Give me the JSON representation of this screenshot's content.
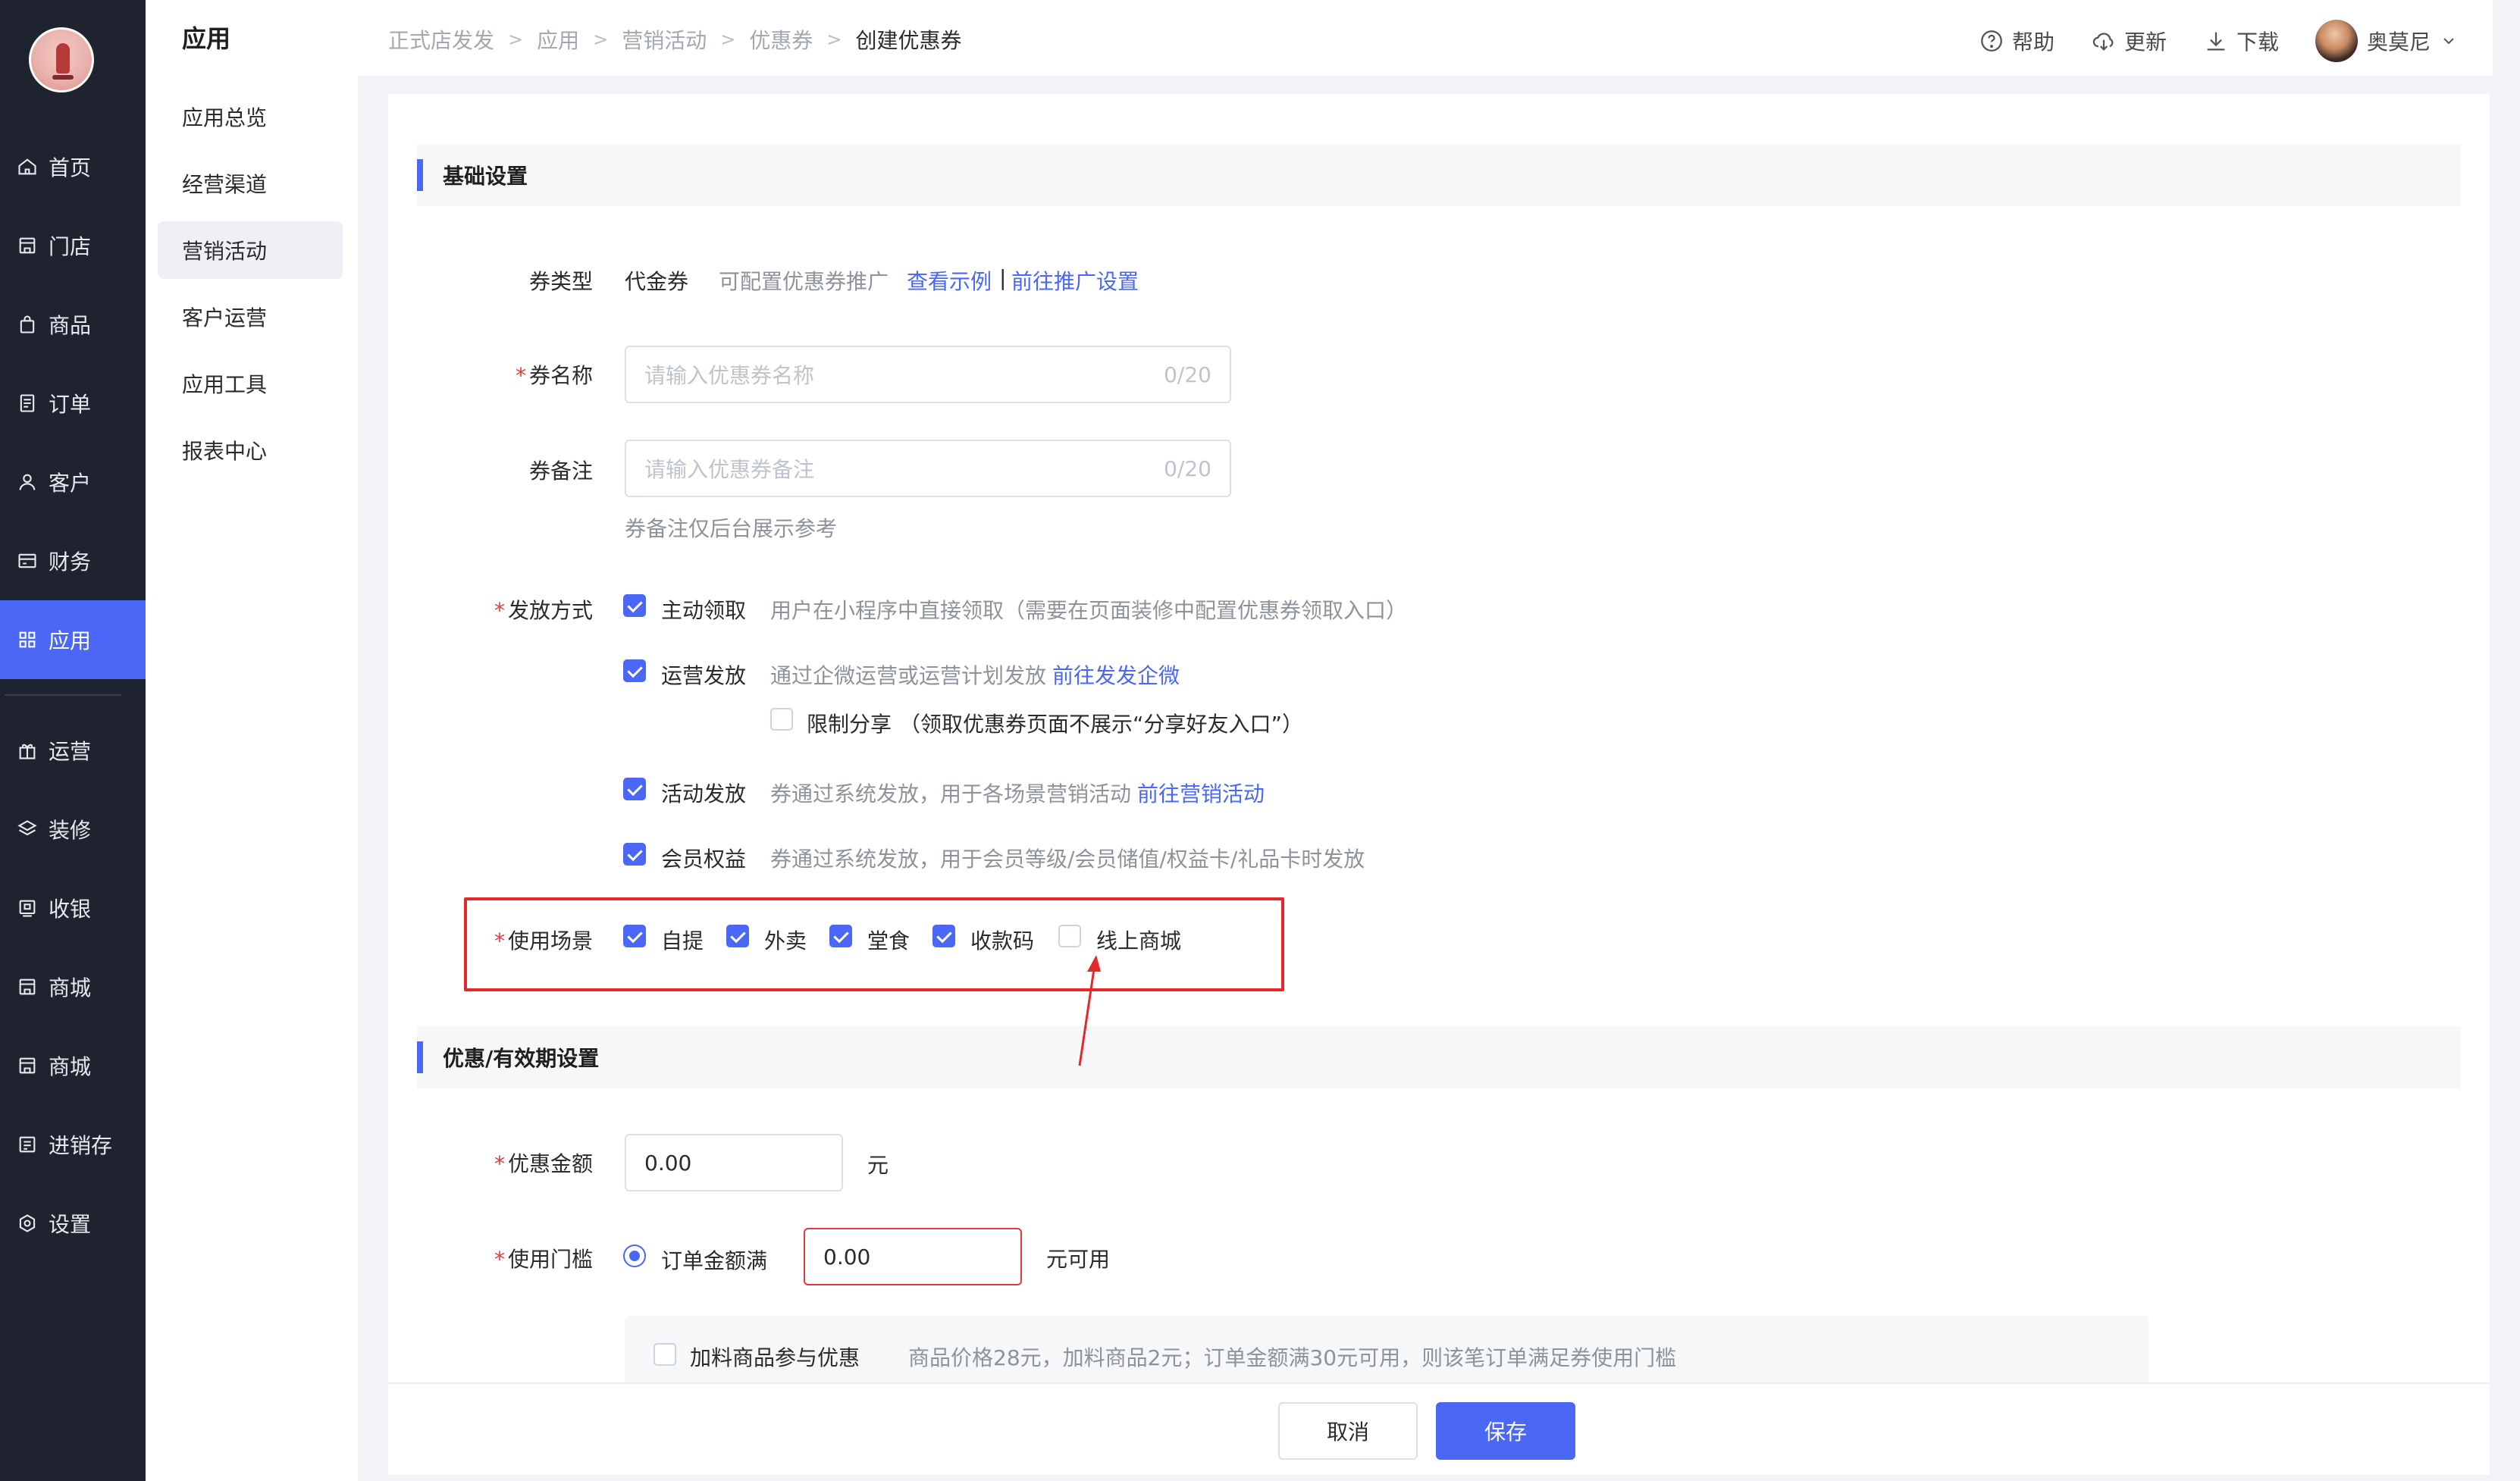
{
  "nav": {
    "items": [
      {
        "label": "首页",
        "icon": "home-icon"
      },
      {
        "label": "门店",
        "icon": "store-icon"
      },
      {
        "label": "商品",
        "icon": "bag-icon"
      },
      {
        "label": "订单",
        "icon": "order-icon"
      },
      {
        "label": "客户",
        "icon": "user-icon"
      },
      {
        "label": "财务",
        "icon": "wallet-icon"
      },
      {
        "label": "应用",
        "icon": "grid-icon",
        "active": true
      },
      {
        "label": "运营",
        "icon": "gift-icon"
      },
      {
        "label": "装修",
        "icon": "layers-icon"
      },
      {
        "label": "收银",
        "icon": "cashier-icon"
      },
      {
        "label": "商城",
        "icon": "store-icon"
      },
      {
        "label": "商城",
        "icon": "store-icon"
      },
      {
        "label": "进销存",
        "icon": "inventory-icon"
      },
      {
        "label": "设置",
        "icon": "settings-icon"
      }
    ]
  },
  "submenu": {
    "title": "应用",
    "items": [
      {
        "label": "应用总览"
      },
      {
        "label": "经营渠道"
      },
      {
        "label": "营销活动",
        "active": true
      },
      {
        "label": "客户运营"
      },
      {
        "label": "应用工具"
      },
      {
        "label": "报表中心"
      }
    ]
  },
  "breadcrumb": [
    "正式店发发",
    "应用",
    "营销活动",
    "优惠券",
    "创建优惠券"
  ],
  "header": {
    "help": "帮助",
    "update": "更新",
    "download": "下载",
    "username": "奥莫尼"
  },
  "basic": {
    "section_title": "基础设置",
    "type_label": "券类型",
    "type_value": "代金券",
    "type_hint": "可配置优惠券推广",
    "type_link1": "查看示例",
    "type_sep": "|",
    "type_link2": "前往推广设置",
    "name_label": "券名称",
    "name_placeholder": "请输入优惠券名称",
    "name_count": "0/20",
    "remark_label": "券备注",
    "remark_placeholder": "请输入优惠券备注",
    "remark_count": "0/20",
    "remark_hint": "券备注仅后台展示参考",
    "method_label": "发放方式",
    "methods": [
      {
        "label": "主动领取",
        "desc": "用户在小程序中直接领取（需要在页面装修中配置优惠券领取入口）",
        "checked": true
      },
      {
        "label": "运营发放",
        "desc": "通过企微运营或运营计划发放",
        "link": "前往发发企微",
        "checked": true
      },
      {
        "label": "活动发放",
        "desc": "券通过系统发放，用于各场景营销活动",
        "link": "前往营销活动",
        "checked": true
      },
      {
        "label": "会员权益",
        "desc": "券通过系统发放，用于会员等级/会员储值/权益卡/礼品卡时发放",
        "checked": true
      }
    ],
    "limit_share_label": "限制分享",
    "limit_share_desc": "（领取优惠券页面不展示“分享好友入口”）",
    "scene_label": "使用场景",
    "scenes": [
      {
        "label": "自提",
        "checked": true
      },
      {
        "label": "外卖",
        "checked": true
      },
      {
        "label": "堂食",
        "checked": true
      },
      {
        "label": "收款码",
        "checked": true
      },
      {
        "label": "线上商城",
        "checked": false
      }
    ]
  },
  "discount": {
    "section_title": "优惠/有效期设置",
    "amount_label": "优惠金额",
    "amount_value": "0.00",
    "amount_unit": "元",
    "threshold_label": "使用门槛",
    "threshold_option": "订单金额满",
    "threshold_value": "0.00",
    "threshold_unit": "元可用",
    "addon_label": "加料商品参与优惠",
    "addon_desc": "商品价格28元，加料商品2元；订单金额满30元可用，则该笔订单满足券使用门槛"
  },
  "footer": {
    "cancel": "取消",
    "save": "保存"
  },
  "colors": {
    "accent": "#4a67f5",
    "nav_bg": "#1f2330",
    "required": "#e5383b",
    "highlight": "#e5282b"
  }
}
